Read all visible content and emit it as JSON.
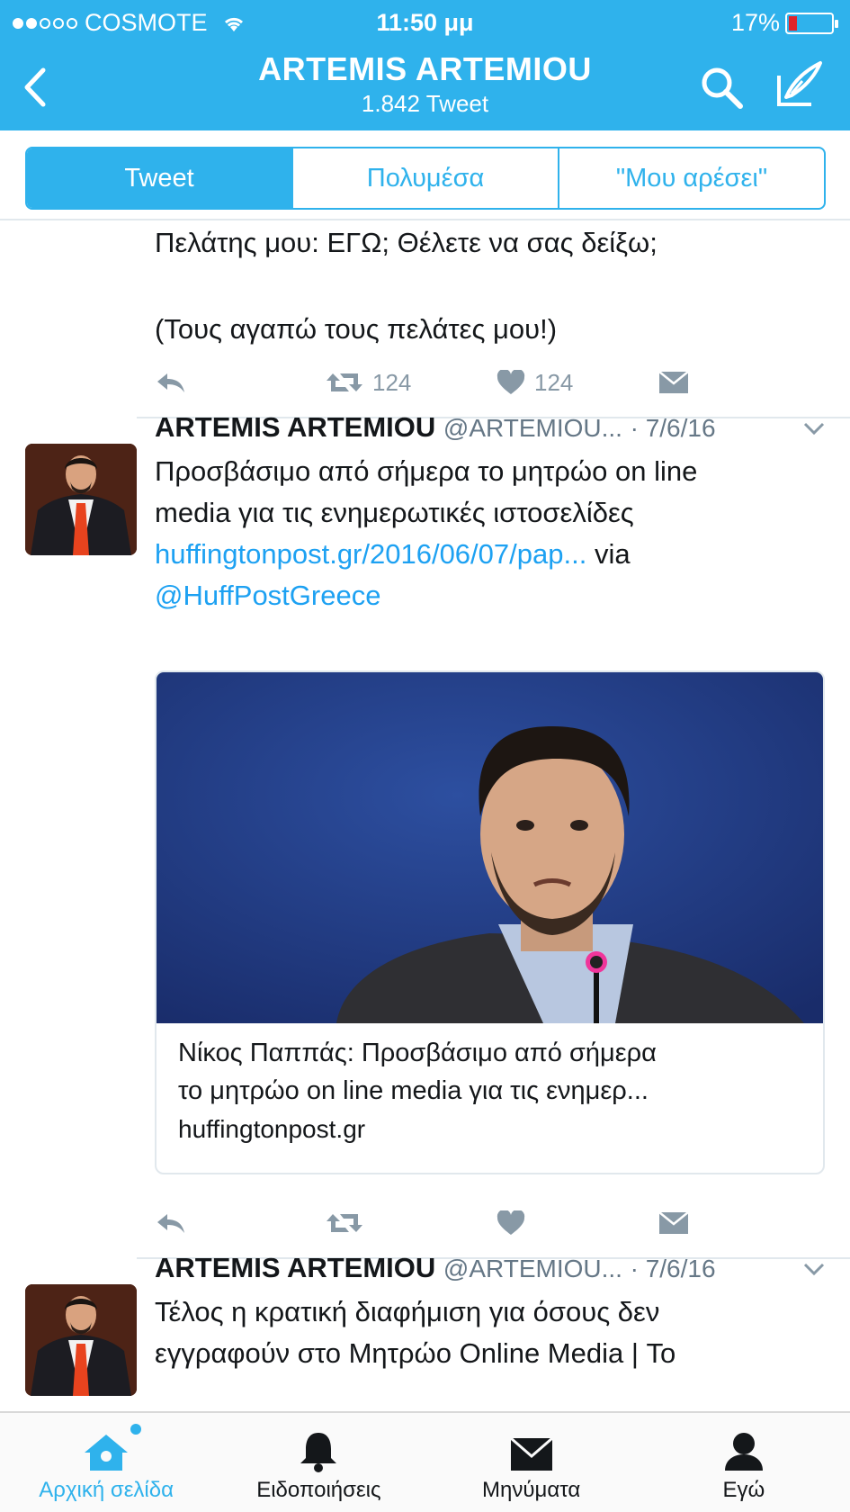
{
  "status_bar": {
    "carrier": "COSMOTE",
    "time": "11:50 μμ",
    "battery": "17%"
  },
  "header": {
    "title": "ARTEMIS ARTEMIOU",
    "subtitle": "1.842 Tweet"
  },
  "segments": [
    {
      "label": "Tweet",
      "active": true
    },
    {
      "label": "Πολυμέσα",
      "active": false
    },
    {
      "label": "\"Μου αρέσει\"",
      "active": false
    }
  ],
  "partial_tweet": {
    "line1": "Πελάτης μου: ΕΓΩ; Θέλετε να σας δείξω;",
    "line2": "(Τους αγαπώ τους πελάτες μου!)",
    "retweets": "124",
    "likes": "124"
  },
  "tweets": [
    {
      "name": "ARTEMIS ARTEMIOU",
      "handle": "@ARTEMIOU...",
      "date": "· 7/6/16",
      "text_line1": "Προσβάσιμο από σήμερα το μητρώο on line",
      "text_line2": "media για τις ενημερωτικές ιστοσελίδες",
      "link": "huffingtonpost.gr/2016/06/07/pap...",
      "via": " via",
      "mention": "@HuffPostGreece",
      "card": {
        "title_line1": "Νίκος Παππάς: Προσβάσιμο από σήμερα",
        "title_line2": "το μητρώο on line media για τις ενημερ...",
        "domain": "huffingtonpost.gr"
      }
    },
    {
      "name": "ARTEMIS ARTEMIOU",
      "handle": "@ARTEMIOU...",
      "date": "· 7/6/16",
      "text_line1": "Τέλος η κρατική διαφήμιση για όσους δεν",
      "text_line2": "εγγραφούν στο Μητρώο Online Media | Το"
    }
  ],
  "tabbar": [
    {
      "label": "Αρχική σελίδα",
      "icon": "home-icon",
      "active": true
    },
    {
      "label": "Ειδοποιήσεις",
      "icon": "bell-icon",
      "active": false
    },
    {
      "label": "Μηνύματα",
      "icon": "envelope-icon",
      "active": false
    },
    {
      "label": "Εγώ",
      "icon": "person-icon",
      "active": false
    }
  ],
  "colors": {
    "accent": "#2fb2ec",
    "link": "#1da1f2",
    "muted": "#8899a6",
    "battery_low": "#e0242b"
  }
}
